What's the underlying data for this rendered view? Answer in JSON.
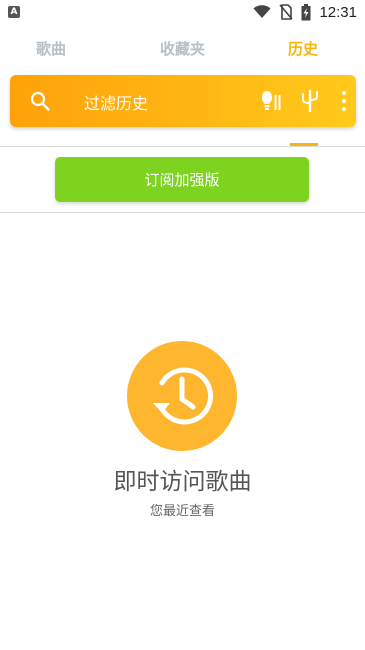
{
  "status_bar": {
    "notification_badge": "A",
    "time": "12:31",
    "icons": [
      "wifi-icon",
      "no-sim-icon",
      "battery-charging-icon"
    ]
  },
  "tabs": [
    {
      "label": "歌曲",
      "active": false
    },
    {
      "label": "收藏夹",
      "active": false
    },
    {
      "label": "历史",
      "active": true
    }
  ],
  "search": {
    "placeholder": "过滤历史",
    "icons": [
      "search-icon",
      "bulb-icon",
      "cactus-icon",
      "more-vert-icon"
    ]
  },
  "subscribe_button": {
    "label": "订阅加强版"
  },
  "empty_state": {
    "icon": "history-icon",
    "title": "即时访问歌曲",
    "subtitle": "您最近查看"
  },
  "colors": {
    "accent": "#f7b60f",
    "search_gradient_start": "#ffa20a",
    "search_gradient_end": "#ffca1c",
    "subscribe_green": "#7ed321",
    "empty_circle": "#ffb62f",
    "tab_inactive": "#b7bfc7"
  }
}
